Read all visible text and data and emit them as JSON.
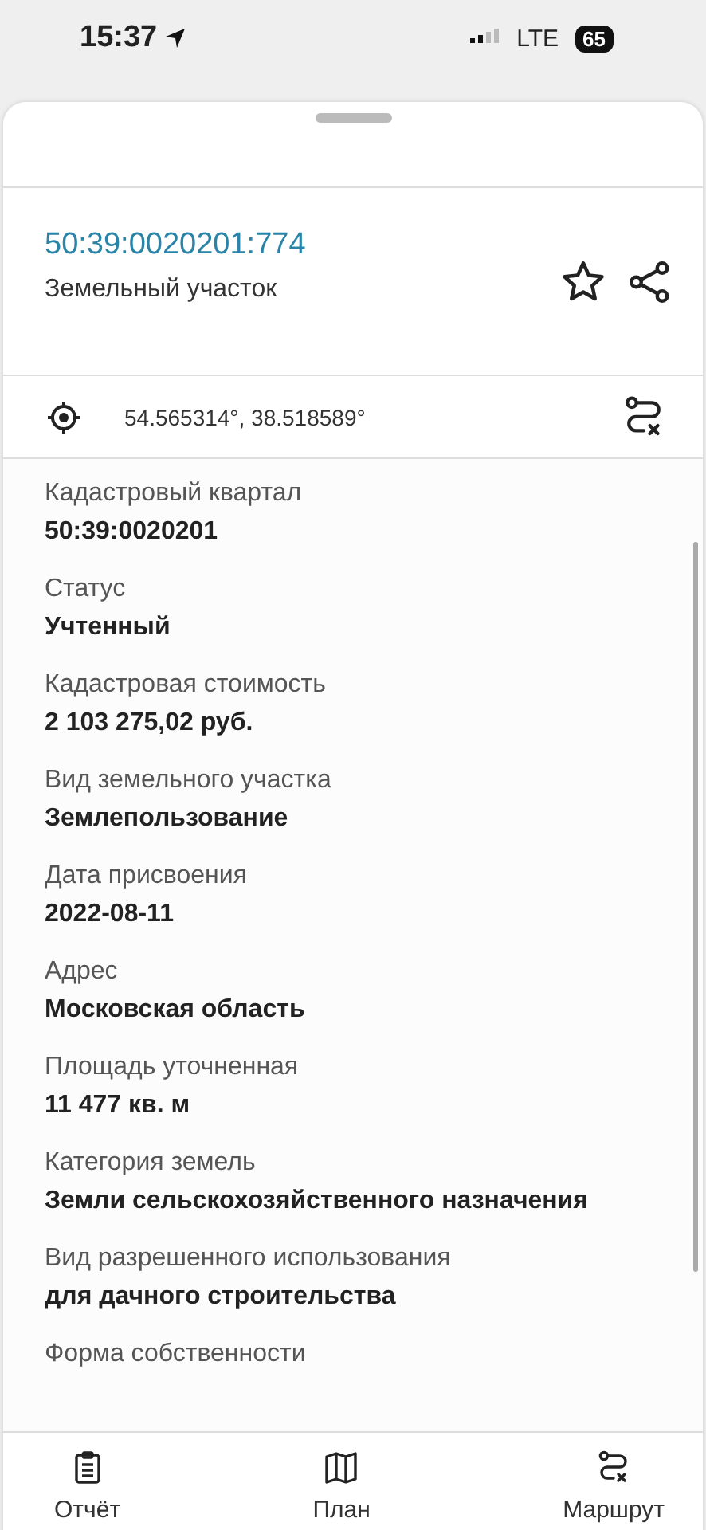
{
  "status_bar": {
    "time": "15:37",
    "network": "LTE",
    "battery": "65"
  },
  "object": {
    "cadastral_number": "50:39:0020201:774",
    "type": "Земельный участок",
    "favorite": false
  },
  "coordinates": "54.565314°, 38.518589°",
  "fields": [
    {
      "label": "Кадастровый квартал",
      "value": "50:39:0020201"
    },
    {
      "label": "Статус",
      "value": "Учтенный"
    },
    {
      "label": "Кадастровая стоимость",
      "value": "2 103 275,02 руб."
    },
    {
      "label": "Вид земельного участка",
      "value": "Землепользование"
    },
    {
      "label": "Дата присвоения",
      "value": "2022-08-11"
    },
    {
      "label": "Адрес",
      "value": "Московская область"
    },
    {
      "label": "Площадь уточненная",
      "value": "11 477 кв. м"
    },
    {
      "label": "Категория земель",
      "value": "Земли сельскохозяйственного назначения"
    },
    {
      "label": "Вид разрешенного использования",
      "value": "для дачного строительства"
    },
    {
      "label": "Форма собственности"
    }
  ],
  "bottom_nav": [
    {
      "kind": "report",
      "label": "Отчёт"
    },
    {
      "kind": "plan",
      "label": "План"
    },
    {
      "kind": "route",
      "label": "Маршрут"
    }
  ]
}
